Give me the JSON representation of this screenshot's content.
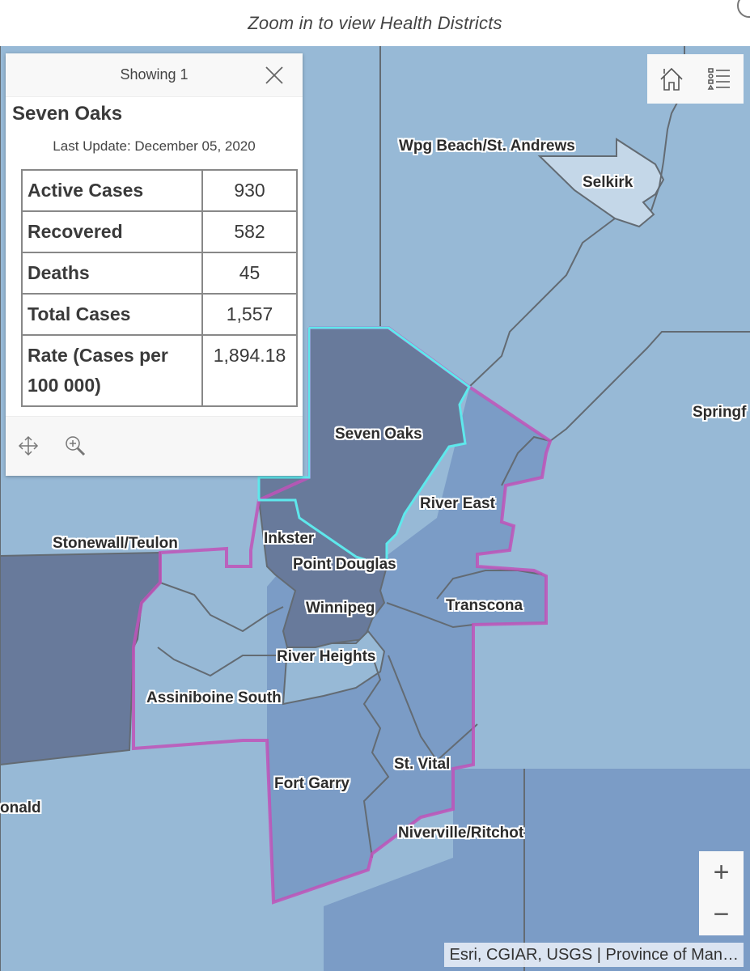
{
  "header": {
    "title": "Zoom in to view Health Districts"
  },
  "popup": {
    "showing_label": "Showing 1",
    "title": "Seven Oaks",
    "last_update": "Last Update: December 05, 2020",
    "rows": [
      {
        "label": "Active Cases",
        "value": "930"
      },
      {
        "label": "Recovered",
        "value": "582"
      },
      {
        "label": "Deaths",
        "value": "45"
      },
      {
        "label": "Total Cases",
        "value": "1,557"
      },
      {
        "label": "Rate (Cases per 100 000)",
        "value": "1,894.18"
      }
    ],
    "actions": [
      {
        "name": "pan-icon",
        "label": "Pan to"
      },
      {
        "name": "zoom-to-icon",
        "label": "Zoom to"
      }
    ]
  },
  "toolbar": {
    "home_icon": "home-icon",
    "legend_icon": "legend-list-icon"
  },
  "zoom": {
    "in_label": "+",
    "out_label": "−"
  },
  "attribution": "Esri, CGIAR, USGS | Province of Man…",
  "map": {
    "colors": {
      "light": "#97b9d6",
      "pale": "#c4d7e8",
      "medium": "#7b9cc6",
      "dark": "#687a9b",
      "border": "#636b73",
      "highlight_magenta": "#c052b8",
      "selected_cyan": "#5ee8ec"
    },
    "labels": [
      {
        "id": "wpg-beach",
        "text": "Wpg Beach/St. Andrews"
      },
      {
        "id": "selkirk",
        "text": "Selkirk"
      },
      {
        "id": "springfield",
        "text": "Springf"
      },
      {
        "id": "seven-oaks",
        "text": "Seven Oaks"
      },
      {
        "id": "river-east",
        "text": "River East"
      },
      {
        "id": "stonewall",
        "text": "Stonewall/Teulon"
      },
      {
        "id": "inkster",
        "text": "Inkster"
      },
      {
        "id": "point-douglas",
        "text": "Point Douglas"
      },
      {
        "id": "winnipeg",
        "text": "Winnipeg"
      },
      {
        "id": "transcona",
        "text": "Transcona"
      },
      {
        "id": "river-heights",
        "text": "River Heights"
      },
      {
        "id": "assiniboine-south",
        "text": "Assiniboine South"
      },
      {
        "id": "st-vital",
        "text": "St. Vital"
      },
      {
        "id": "fort-garry",
        "text": "Fort Garry"
      },
      {
        "id": "macdonald",
        "text": "onald"
      },
      {
        "id": "niverville",
        "text": "Niverville/Ritchot"
      }
    ]
  }
}
